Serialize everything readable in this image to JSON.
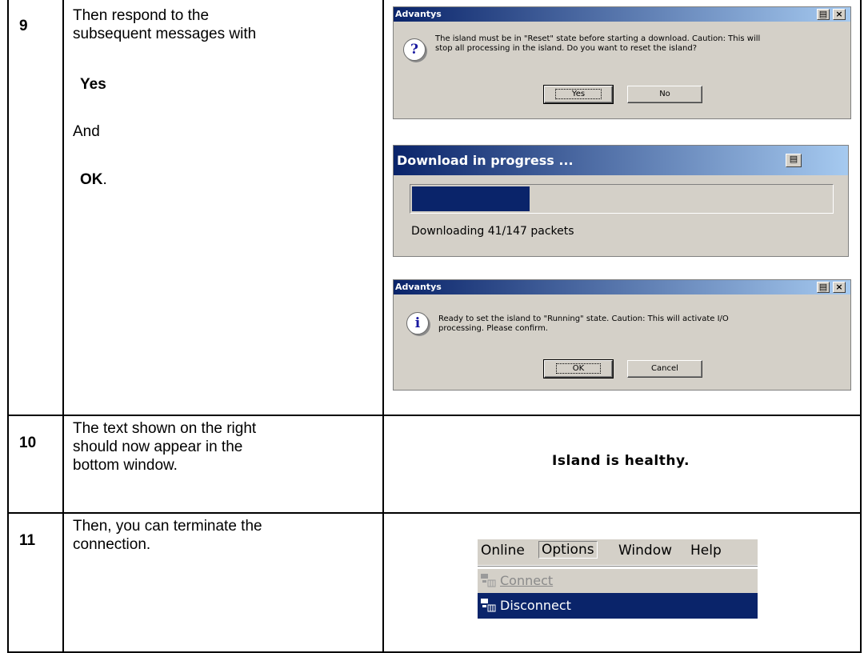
{
  "rows": [
    {
      "step": "9",
      "instruction": {
        "line1": "Then respond to the",
        "line2": "subsequent messages with",
        "emph1": "Yes",
        "connector": "And",
        "emph2": "OK",
        "end": "."
      }
    },
    {
      "step": "10",
      "instruction": {
        "line1": "The text shown on the right",
        "line2": "should now appear in the",
        "line3": "bottom window."
      }
    },
    {
      "step": "11",
      "instruction": {
        "line1": "Then, you can terminate the",
        "line2": "connection."
      }
    }
  ],
  "dialog_reset": {
    "title": "Advantys",
    "icon": "question-icon",
    "message_line1": "The island must be in \"Reset\" state before starting a download. Caution: This will",
    "message_line2": "stop all processing in the island. Do you want to reset the island?",
    "yes_label": "Yes",
    "no_label": "No"
  },
  "dialog_progress": {
    "title": "Download in progress ...",
    "progress": 0.28,
    "status": "Downloading 41/147 packets"
  },
  "dialog_running": {
    "title": "Advantys",
    "icon": "info-icon",
    "message_line1": "Ready to set the island to \"Running\" state. Caution: This will activate I/O",
    "message_line2": "processing. Please confirm.",
    "ok_label": "OK",
    "cancel_label": "Cancel"
  },
  "status_text": "Island is healthy.",
  "menu": {
    "items": [
      "Online",
      "Options",
      "Window",
      "Help"
    ],
    "dropdown": [
      {
        "label": "Connect",
        "enabled": false,
        "icon": "connect-icon"
      },
      {
        "label": "Disconnect",
        "enabled": true,
        "selected": true,
        "icon": "disconnect-icon"
      }
    ]
  },
  "colors": {
    "titlebar": "#0a246a",
    "dialog_bg": "#d4d0c8",
    "selection": "#0a246a"
  }
}
